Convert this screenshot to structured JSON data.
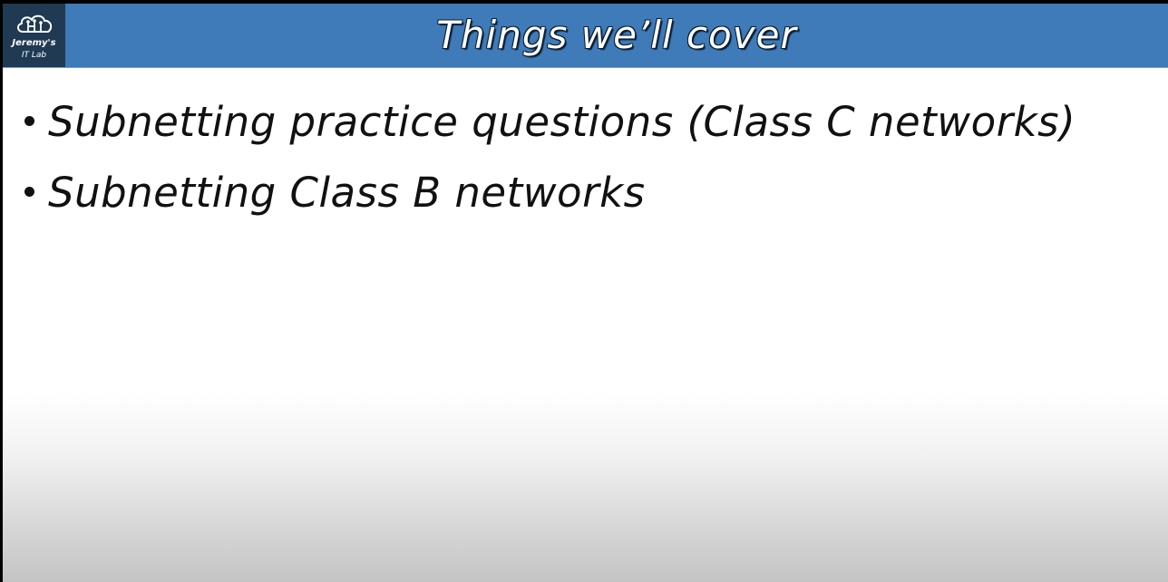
{
  "logo": {
    "line1": "Jeremy's",
    "line2": "IT Lab",
    "icon": "cloud-circuit-icon"
  },
  "slide": {
    "title": "Things we’ll cover",
    "bullets": [
      "Subnetting practice questions (Class C networks)",
      "Subnetting Class B networks"
    ]
  },
  "colors": {
    "title_bar": "#3e7bb8",
    "logo_bg": "#1f3a52",
    "text": "#111111"
  }
}
